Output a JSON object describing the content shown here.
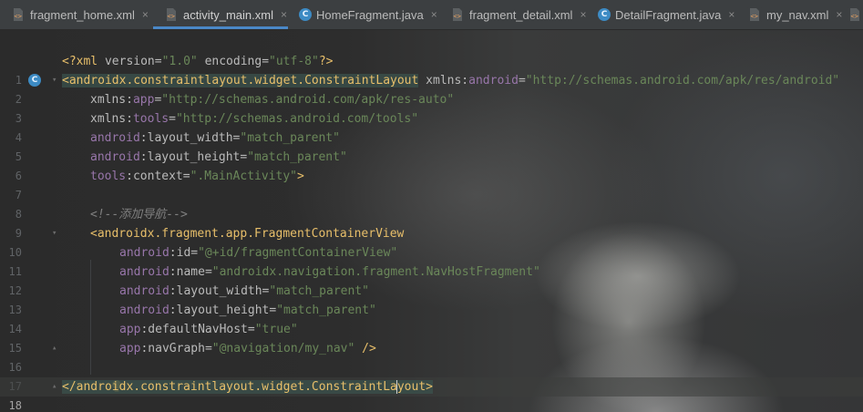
{
  "tabs": [
    {
      "label": "fragment_home.xml",
      "type": "xml",
      "active": false
    },
    {
      "label": "activity_main.xml",
      "type": "xml",
      "active": true
    },
    {
      "label": "HomeFragment.java",
      "type": "java",
      "active": false
    },
    {
      "label": "fragment_detail.xml",
      "type": "xml",
      "active": false
    },
    {
      "label": "DetailFragment.java",
      "type": "java",
      "active": false
    },
    {
      "label": "my_nav.xml",
      "type": "xml",
      "active": false
    }
  ],
  "tab_close_glyph": "×",
  "java_icon_letter": "C",
  "gutter": {
    "class_marker_letter": "C",
    "line_numbers": [
      "1",
      "2",
      "3",
      "4",
      "5",
      "6",
      "7",
      "8",
      "9",
      "10",
      "11",
      "12",
      "13",
      "14",
      "15",
      "16",
      "17",
      "18"
    ],
    "current_line": "18"
  },
  "code": {
    "l1": {
      "open": "<?",
      "name": "xml",
      "a1": "version",
      "v1": "\"1.0\"",
      "a2": "encoding",
      "v2": "\"utf-8\"",
      "close": "?>"
    },
    "l2": {
      "open": "<",
      "name": "androidx.constraintlayout.widget.ConstraintLayout",
      "a": "xmlns:",
      "ns": "android",
      "eq": "=",
      "v": "\"http://schemas.android.com/apk/res/android\""
    },
    "l3": {
      "a": "xmlns:",
      "ns": "app",
      "eq": "=",
      "v": "\"http://schemas.android.com/apk/res-auto\""
    },
    "l4": {
      "a": "xmlns:",
      "ns": "tools",
      "eq": "=",
      "v": "\"http://schemas.android.com/tools\""
    },
    "l5": {
      "ns": "android",
      "a": ":layout_width",
      "eq": "=",
      "v": "\"match_parent\""
    },
    "l6": {
      "ns": "android",
      "a": ":layout_height",
      "eq": "=",
      "v": "\"match_parent\""
    },
    "l7": {
      "ns": "tools",
      "a": ":context",
      "eq": "=",
      "v": "\".MainActivity\"",
      "close": ">"
    },
    "l9": {
      "comment": "<!--添加导航-->"
    },
    "l10": {
      "open": "<",
      "name": "androidx.fragment.app.FragmentContainerView"
    },
    "l11": {
      "ns": "android",
      "a": ":id",
      "eq": "=",
      "v": "\"@+id/fragmentContainerView\""
    },
    "l12": {
      "ns": "android",
      "a": ":name",
      "eq": "=",
      "v": "\"androidx.navigation.fragment.NavHostFragment\""
    },
    "l13": {
      "ns": "android",
      "a": ":layout_width",
      "eq": "=",
      "v": "\"match_parent\""
    },
    "l14": {
      "ns": "android",
      "a": ":layout_height",
      "eq": "=",
      "v": "\"match_parent\""
    },
    "l15": {
      "ns": "app",
      "a": ":defaultNavHost",
      "eq": "=",
      "v": "\"true\""
    },
    "l16": {
      "ns": "app",
      "a": ":navGraph",
      "eq": "=",
      "v": "\"@navigation/my_nav\"",
      "close": " />"
    },
    "l18": {
      "open": "</",
      "name_a": "androidx.constraintlayout.widget.ConstraintLa",
      "name_b": "yout",
      "close": ">"
    }
  },
  "colors": {
    "tag": "#e8bf6a",
    "namespace": "#9876aa",
    "string": "#6a8759",
    "comment": "#808080",
    "attribute": "#bababa",
    "tab_underline": "#4a88c7"
  }
}
